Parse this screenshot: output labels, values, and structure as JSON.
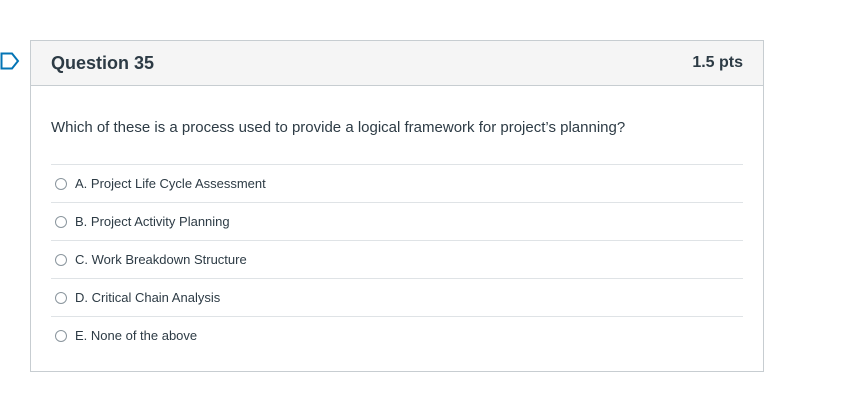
{
  "question": {
    "title": "Question 35",
    "points": "1.5 pts",
    "text": "Which of these is a process used to provide a logical framework for project’s planning?",
    "answers": [
      {
        "label": "A. Project Life Cycle Assessment",
        "selected": false
      },
      {
        "label": "B. Project Activity Planning",
        "selected": false
      },
      {
        "label": "C. Work Breakdown Structure",
        "selected": false
      },
      {
        "label": "D. Critical Chain Analysis",
        "selected": false
      },
      {
        "label": "E. None of the above",
        "selected": false
      }
    ]
  },
  "icons": {
    "flag": "flag-outline-icon"
  },
  "colors": {
    "flag": "#0374b5",
    "header_bg": "#f5f5f5",
    "border": "#c7cdd1",
    "text": "#2d3b45"
  }
}
